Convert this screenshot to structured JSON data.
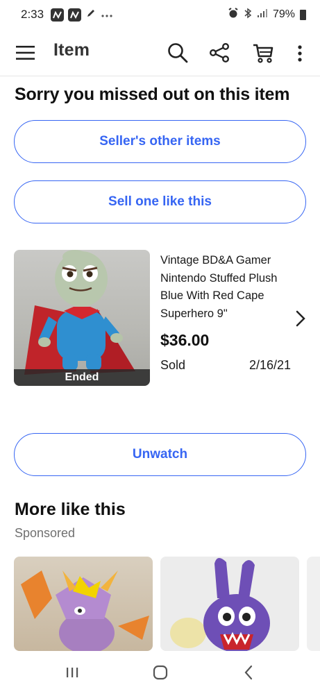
{
  "status_bar": {
    "time": "2:33",
    "battery": "79%",
    "icons": [
      "n-notification-icon",
      "n-notification-icon",
      "pen-icon",
      "more-dots-icon",
      "alarm-icon",
      "bluetooth-icon",
      "signal-icon",
      "battery-icon"
    ]
  },
  "app_bar": {
    "title": "Item",
    "icons": [
      "menu-icon",
      "search-icon",
      "share-icon",
      "cart-icon",
      "overflow-menu-icon"
    ]
  },
  "main": {
    "heading": "Sorry you missed out on this item",
    "sellers_other_items": "Seller's other items",
    "sell_one_like_this": "Sell one like this",
    "unwatch": "Unwatch"
  },
  "item": {
    "title": "Vintage BD&A Gamer Nintendo Stuffed Plush Blue With Red Cape Superhero 9\"",
    "price": "$36.00",
    "status_label": "Sold",
    "sold_date": "2/16/21",
    "badge": "Ended"
  },
  "more_like_this": {
    "title": "More like this",
    "subtitle": "Sponsored"
  },
  "colors": {
    "accent": "#3665f3",
    "text": "#191919",
    "muted": "#707070"
  }
}
